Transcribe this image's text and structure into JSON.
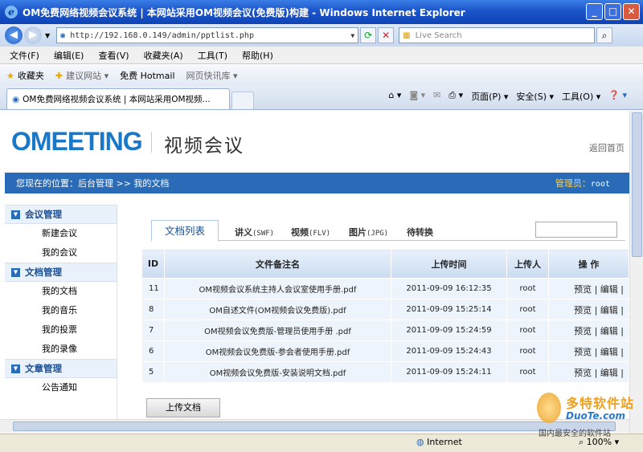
{
  "window": {
    "title": "OM免费网络视频会议系统 | 本网站采用OM视频会议(免费版)构建 - Windows Internet Explorer"
  },
  "address": {
    "url": "http://192.168.0.149/admin/pptlist.php",
    "search_placeholder": "Live Search"
  },
  "menu": [
    "文件(F)",
    "编辑(E)",
    "查看(V)",
    "收藏夹(A)",
    "工具(T)",
    "帮助(H)"
  ],
  "favorites": {
    "label": "收藏夹",
    "items": [
      "建议网站 ▾",
      "免费 Hotmail",
      "网页快讯库 ▾"
    ]
  },
  "tab": {
    "title": "OM免费网络视频会议系统 | 本网站采用OM视频..."
  },
  "tools": [
    "页面(P) ▾",
    "安全(S) ▾",
    "工具(O) ▾"
  ],
  "site": {
    "logo": "OMEETING",
    "logo_text": "视频会议",
    "back_link": "返回首页",
    "breadcrumb": "您现在的位置：后台管理 >> 我的文档",
    "admin_label": "管理员：",
    "admin_name": "root"
  },
  "sidebar": [
    {
      "title": "会议管理",
      "items": [
        "新建会议",
        "我的会议"
      ]
    },
    {
      "title": "文档管理",
      "items": [
        "我的文档",
        "我的音乐",
        "我的投票",
        "我的录像"
      ]
    },
    {
      "title": "文章管理",
      "items": [
        "公告通知"
      ]
    }
  ],
  "doc_tabs": {
    "active": "文档列表",
    "others": [
      {
        "label": "讲义",
        "sub": "(SWF)"
      },
      {
        "label": "视频",
        "sub": "(FLV)"
      },
      {
        "label": "图片",
        "sub": "(JPG)"
      },
      {
        "label": "待转换",
        "sub": ""
      }
    ]
  },
  "table": {
    "headers": [
      "ID",
      "文件备注名",
      "上传时间",
      "上传人",
      "操 作"
    ],
    "rows": [
      {
        "id": "11",
        "name": "OM视频会议系统主持人会议室使用手册.pdf",
        "time": "2011-09-09 16:12:35",
        "user": "root",
        "ops": "预览 | 编辑 |"
      },
      {
        "id": "8",
        "name": "OM自述文件(OM视频会议免费版).pdf",
        "time": "2011-09-09 15:25:14",
        "user": "root",
        "ops": "预览 | 编辑 |"
      },
      {
        "id": "7",
        "name": "OM视频会议免费版-管理员使用手册 .pdf",
        "time": "2011-09-09 15:24:59",
        "user": "root",
        "ops": "预览 | 编辑 |"
      },
      {
        "id": "6",
        "name": "OM视频会议免费版-参会者使用手册.pdf",
        "time": "2011-09-09 15:24:43",
        "user": "root",
        "ops": "预览 | 编辑 |"
      },
      {
        "id": "5",
        "name": "OM视频会议免费版-安装说明文档.pdf",
        "time": "2011-09-09 15:24:11",
        "user": "root",
        "ops": "预览 | 编辑 |"
      }
    ]
  },
  "upload_button": "上传文档",
  "status": {
    "zone": "Internet",
    "zoom": "100%"
  },
  "watermark": {
    "line1": "多特软件站",
    "line2": "DuoTe.com",
    "line3": "国内最安全的软件站"
  }
}
